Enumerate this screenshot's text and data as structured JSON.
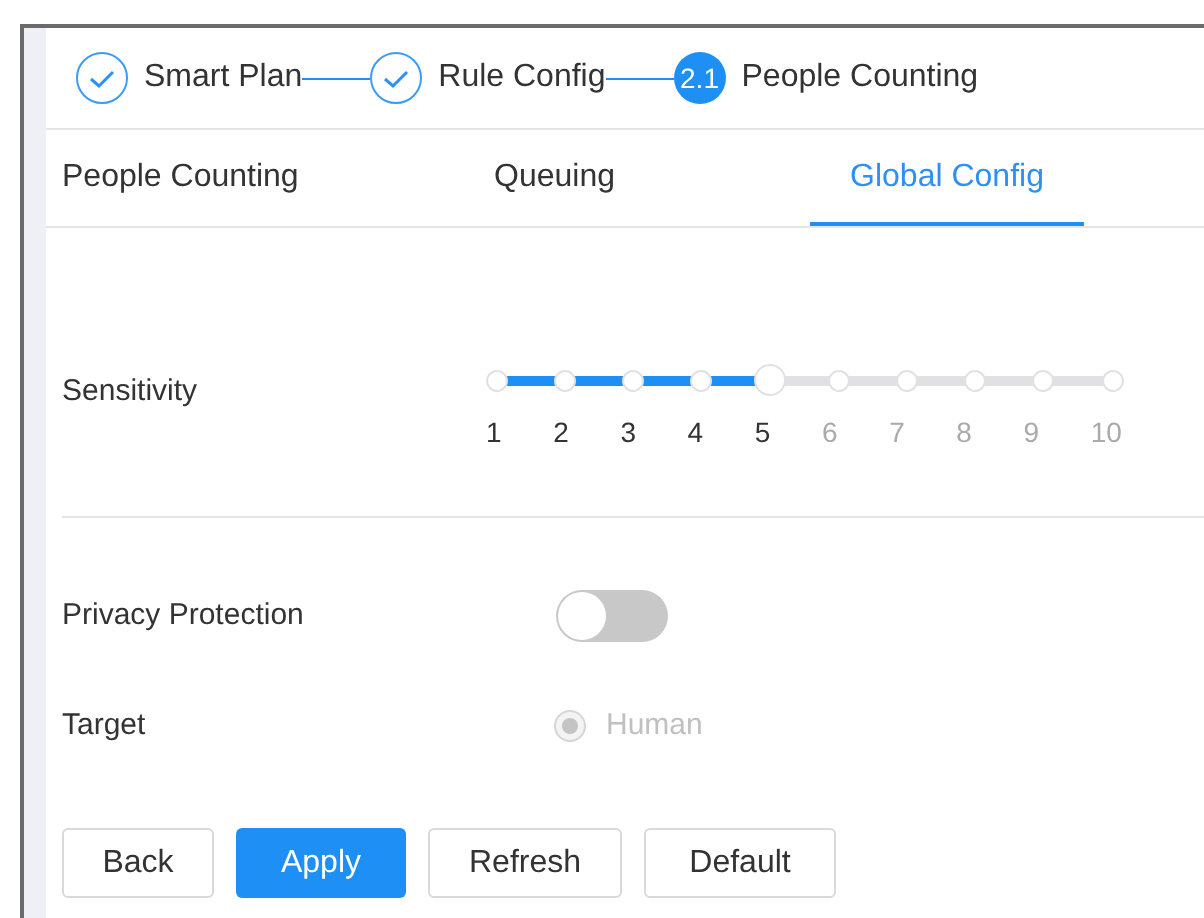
{
  "steps": [
    {
      "label": "Smart Plan",
      "completed": true
    },
    {
      "label": "Rule Config",
      "completed": true
    },
    {
      "label": "People Counting",
      "completed": false,
      "number": "2.1"
    }
  ],
  "tabs": [
    {
      "label": "People Counting",
      "selected": false
    },
    {
      "label": "Queuing",
      "selected": false
    },
    {
      "label": "Global Config",
      "selected": true
    }
  ],
  "sensitivity": {
    "label": "Sensitivity",
    "level": 0.444,
    "ticks": [
      "1",
      "2",
      "3",
      "4",
      "5",
      "6",
      "7",
      "8",
      "9",
      "10"
    ]
  },
  "privacy_protection": {
    "label": "Privacy Protection",
    "on": false
  },
  "target": {
    "label": "Target",
    "option": "Human",
    "selected": true,
    "disabled": true
  },
  "buttons": [
    {
      "label": "Back",
      "primary": false
    },
    {
      "label": "Apply",
      "primary": true
    },
    {
      "label": "Refresh",
      "primary": false
    },
    {
      "label": "Default",
      "primary": false
    }
  ]
}
